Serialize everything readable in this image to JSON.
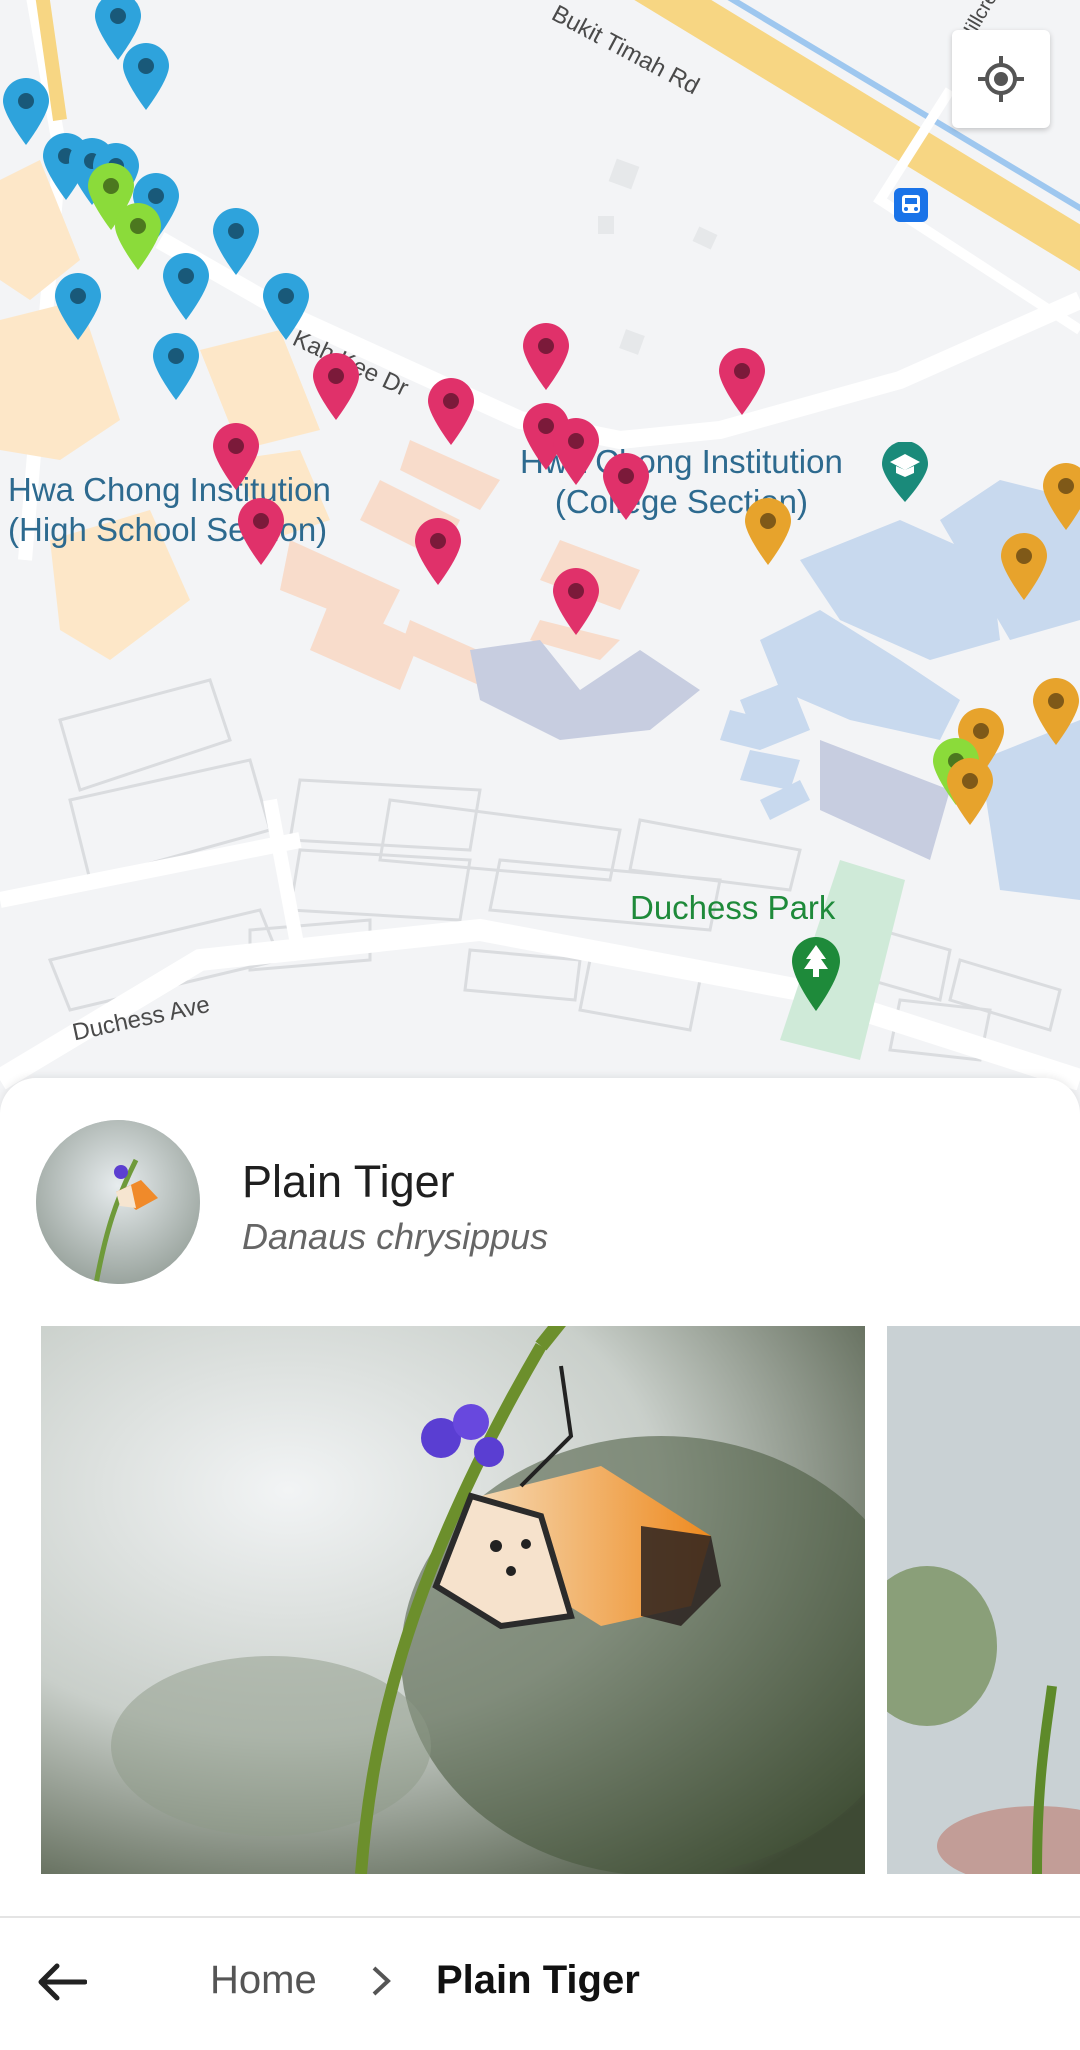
{
  "map": {
    "labels": {
      "hci_high_line1": "Hwa Chong Institution",
      "hci_high_line2": "(High School Section)",
      "hci_college_line1": "Hwa Chong Institution",
      "hci_college_line2": "(College Section)",
      "park": "Duchess Park"
    },
    "streets": {
      "top_road": "Bukit Timah Rd",
      "kah_hee": "Kah Kee Dr",
      "hillcrest": "Hillcrest",
      "duchess_ave": "Duchess Ave"
    },
    "pin_colors": {
      "blue": "#2ea3dc",
      "green": "#8bdb3a",
      "red": "#e0316a",
      "orange": "#e7a32c"
    },
    "locate_icon": "my-location-icon"
  },
  "species": {
    "common_name": "Plain Tiger",
    "scientific_name": "Danaus chrysippus"
  },
  "breadcrumb": {
    "back_icon": "arrow-left-icon",
    "home": "Home",
    "separator_icon": "chevron-right-icon",
    "current": "Plain Tiger"
  }
}
